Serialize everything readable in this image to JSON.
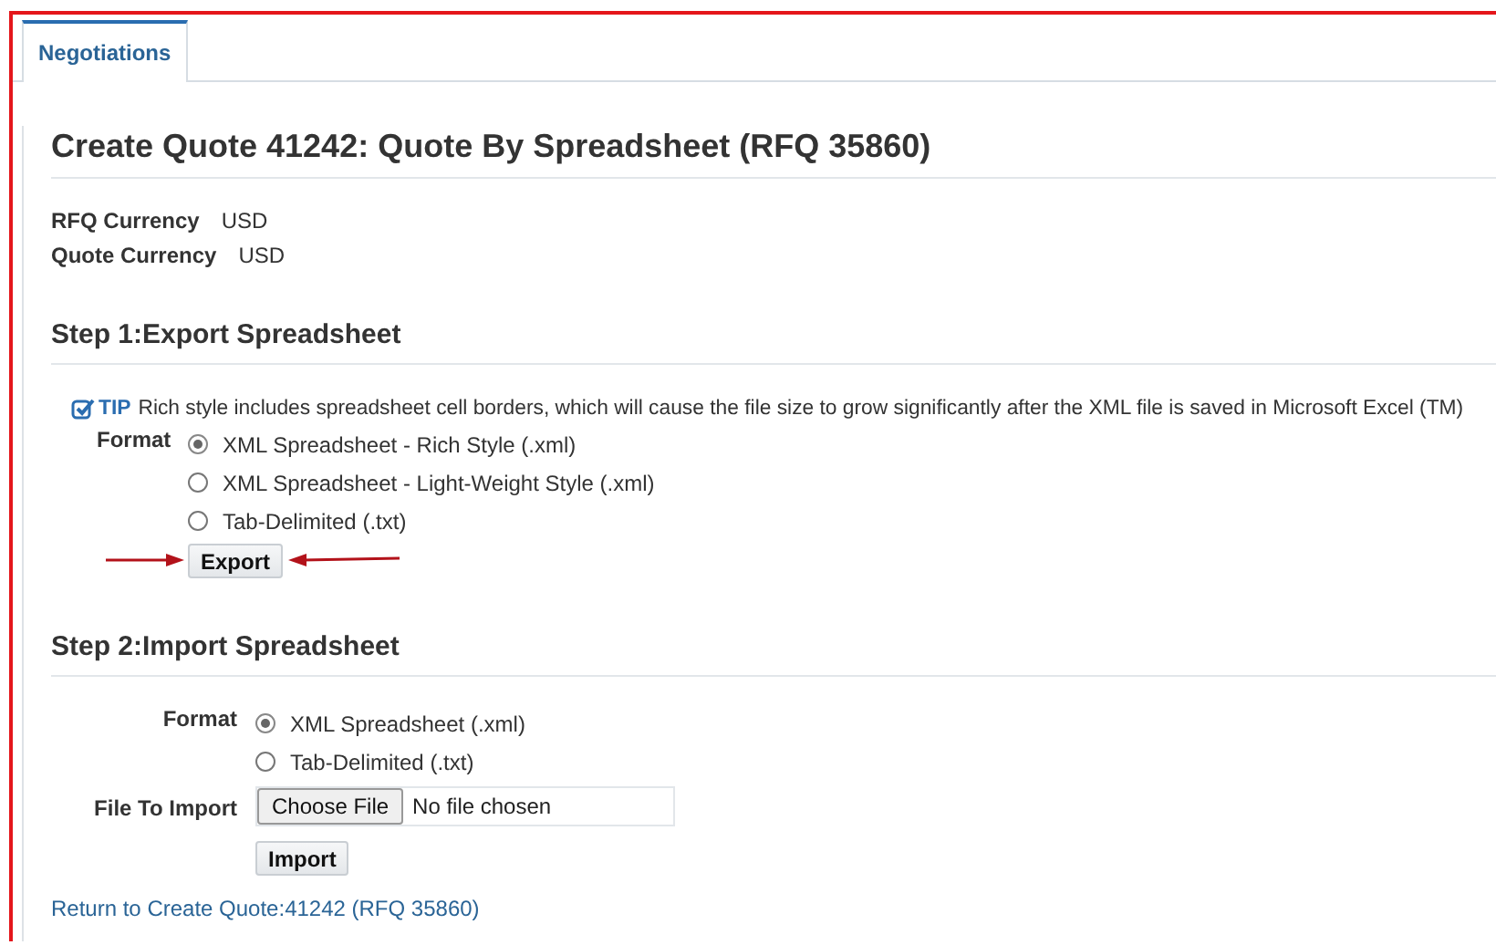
{
  "tabs": [
    {
      "label": "Negotiations",
      "selected": true
    }
  ],
  "title": "Create Quote 41242: Quote By Spreadsheet (RFQ 35860)",
  "currencies": [
    {
      "label": "RFQ Currency",
      "value": "USD"
    },
    {
      "label": "Quote Currency",
      "value": "USD"
    }
  ],
  "export": {
    "heading": "Step 1:Export Spreadsheet",
    "tip_label": "TIP",
    "tip": "Rich style includes spreadsheet cell borders, which will cause the file size to grow significantly after the XML file is saved in Microsoft Excel (TM)",
    "format_label": "Format",
    "options": [
      {
        "label": "XML Spreadsheet - Rich Style (.xml)",
        "selected": true
      },
      {
        "label": "XML Spreadsheet - Light-Weight Style (.xml)",
        "selected": false
      },
      {
        "label": "Tab-Delimited (.txt)",
        "selected": false
      }
    ],
    "button": "Export"
  },
  "import": {
    "heading": "Step 2:Import Spreadsheet",
    "format_label": "Format",
    "options": [
      {
        "label": "XML Spreadsheet (.xml)",
        "selected": true
      },
      {
        "label": "Tab-Delimited (.txt)",
        "selected": false
      }
    ],
    "file_label": "File To Import",
    "file_button": "Choose File",
    "file_status": "No file chosen",
    "button": "Import"
  },
  "link": "Return to Create Quote:41242 (RFQ 35860)"
}
